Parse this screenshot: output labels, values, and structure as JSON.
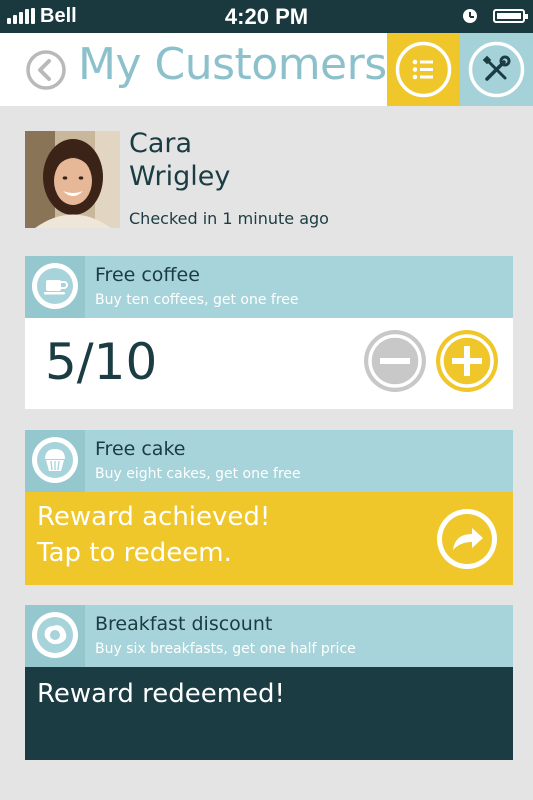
{
  "status_bar": {
    "carrier": "Bell",
    "time": "4:20 PM"
  },
  "header": {
    "title": "My Customers"
  },
  "customer": {
    "first_name": "Cara",
    "last_name": "Wrigley",
    "checkin": "Checked in 1 minute ago"
  },
  "rewards": [
    {
      "title": "Free coffee",
      "subtitle": "Buy ten coffees, get one free",
      "icon": "coffee-cup-icon",
      "progress": "5/10"
    },
    {
      "title": "Free cake",
      "subtitle": "Buy eight cakes, get one free",
      "icon": "cupcake-icon",
      "status_line1": "Reward achieved!",
      "status_line2": "Tap to redeem."
    },
    {
      "title": "Breakfast discount",
      "subtitle": "Buy six breakfasts, get one half price",
      "icon": "fried-egg-icon",
      "status": "Reward redeemed!"
    }
  ],
  "colors": {
    "teal": "#a7d3da",
    "yellow": "#efc72b",
    "dark": "#1a3c42",
    "title": "#8cc1cc"
  }
}
